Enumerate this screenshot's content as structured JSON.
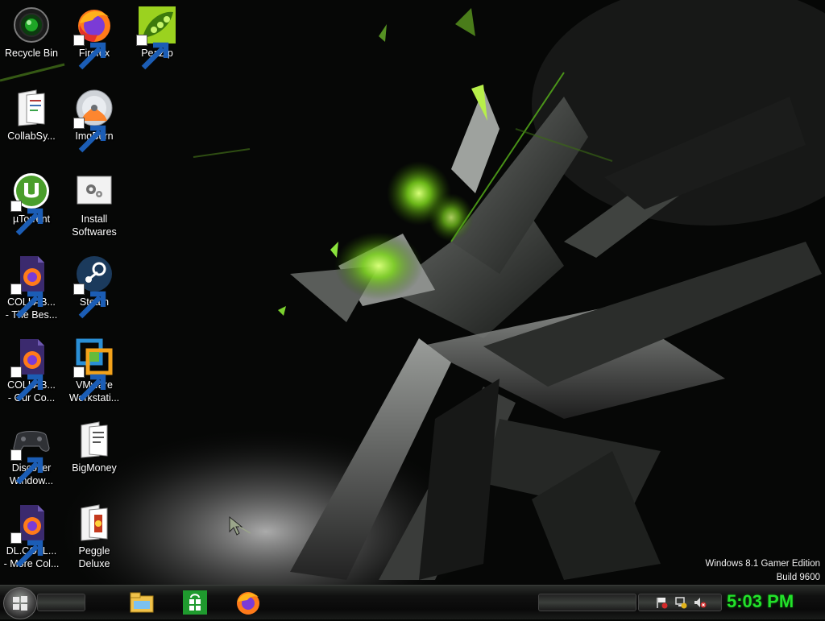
{
  "desktop": {
    "icons": [
      {
        "label": "Recycle Bin",
        "icon": "recycle-bin-icon"
      },
      {
        "label": "Firefox",
        "icon": "firefox-icon"
      },
      {
        "label": "PeaZip",
        "icon": "peazip-icon"
      },
      {
        "label": "CollabSy...",
        "icon": "folder-doc-icon"
      },
      {
        "label": "ImgBurn",
        "icon": "disc-icon"
      },
      {
        "label": "µTorrent",
        "icon": "utorrent-icon"
      },
      {
        "label": "Install",
        "label2": "Softwares",
        "icon": "settings-icon"
      },
      {
        "label": "COLLAB...",
        "label2": "- The Bes...",
        "icon": "firefox-file-icon"
      },
      {
        "label": "Steam",
        "icon": "steam-icon"
      },
      {
        "label": "COLLAB...",
        "label2": "- Our Co...",
        "icon": "firefox-file-icon"
      },
      {
        "label": "VMware",
        "label2": "Workstati...",
        "icon": "vmware-icon"
      },
      {
        "label": "Discover",
        "label2": "Window...",
        "icon": "gamepad-icon"
      },
      {
        "label": "BigMoney",
        "icon": "folder-doc-icon"
      },
      {
        "label": "DL.COLL...",
        "label2": "- More Col...",
        "icon": "firefox-file-icon"
      },
      {
        "label": "Peggle",
        "label2": "Deluxe",
        "icon": "folder-doc-icon"
      }
    ]
  },
  "watermark": {
    "line1": "Windows 8.1 Gamer Edition",
    "line2": "Build 9600"
  },
  "taskbar": {
    "pinned": [
      "file-explorer-icon",
      "store-icon",
      "firefox-icon"
    ],
    "tray": [
      "flag-icon",
      "network-icon",
      "volume-muted-icon"
    ],
    "clock": "5:03 PM"
  },
  "colors": {
    "accent_green": "#22e22a",
    "background": "#050605"
  }
}
